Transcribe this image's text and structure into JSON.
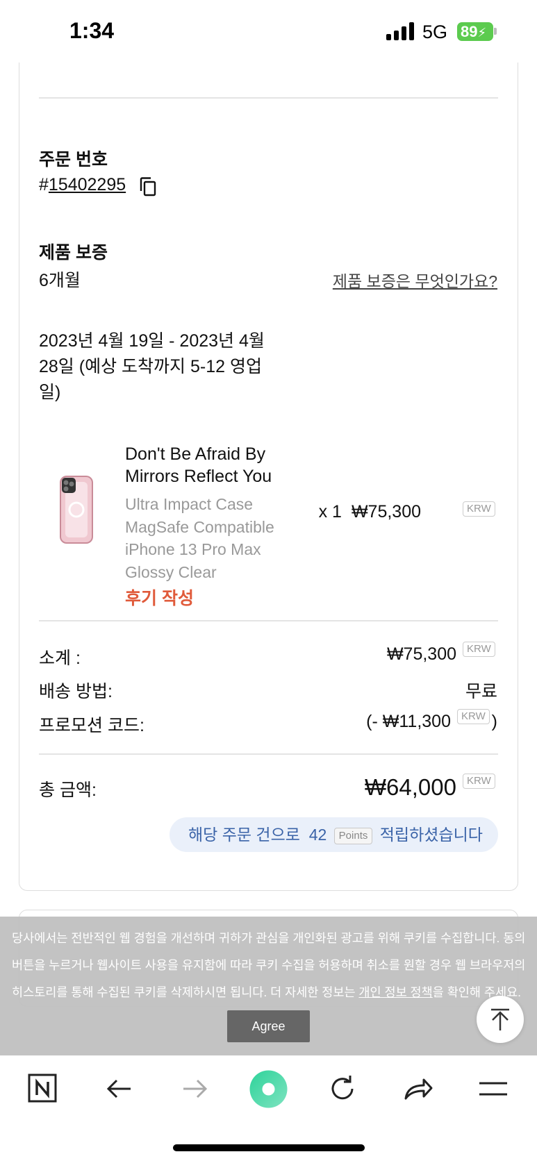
{
  "status_bar": {
    "time": "1:34",
    "network": "5G",
    "battery": "89"
  },
  "order": {
    "order_number_label": "주문 번호",
    "order_number_prefix": "#",
    "order_number": "15402295",
    "warranty_label": "제품 보증",
    "warranty_value": "6개월",
    "warranty_link": "제품 보증은 무엇인가요?",
    "delivery_estimate": "2023년 4월 19일 - 2023년 4월 28일 (예상 도착까지 5-12 영업일)"
  },
  "product": {
    "name": "Don't Be Afraid By Mirrors Reflect You",
    "variant_lines": [
      "Ultra Impact Case",
      "MagSafe Compatible",
      "iPhone 13 Pro Max",
      "Glossy Clear"
    ],
    "review_link": "후기 작성",
    "quantity": "x 1",
    "price": "₩75,300",
    "currency": "KRW"
  },
  "summary": {
    "subtotal_label": "소계 :",
    "subtotal_value": "₩75,300",
    "shipping_label": "배송 방법:",
    "shipping_value": "무료",
    "promo_label": "프로모션 코드:",
    "promo_prefix": "(- ",
    "promo_value": "₩11,300",
    "promo_suffix": ")",
    "total_label": "총 금액:",
    "total_value": "₩64,000",
    "currency": "KRW"
  },
  "points": {
    "text_before": "해당 주문 건으로",
    "amount": "42",
    "unit": "Points",
    "text_after": "적립하셨습니다"
  },
  "cookie_banner": {
    "text": "당사에서는 전반적인 웹 경험을 개선하며 귀하가 관심을 개인화된 광고를 위해 쿠키를 수집합니다. 동의 버튼을 누르거나 웹사이트 사용을 유지함에 따라 쿠키 수집을 허용하며 취소를 원할 경우 웹 브라우저의 히스토리를 통해 수집된 쿠키를 삭제하시면 됩니다. 더 자세한 정보는 ",
    "link": "개인 정보 정책",
    "text_after": "을 확인해 주세요.",
    "agree_label": "Agree"
  },
  "colors": {
    "review_accent": "#e05a3a",
    "points_text": "#3a63a8",
    "points_bg": "#eaf0fa",
    "battery": "#5ccb4f",
    "browser_accent": "#3fd6a0"
  },
  "toolbar_icons": [
    "naver-n-icon",
    "back-arrow-icon",
    "forward-arrow-icon",
    "green-dot-icon",
    "reload-icon",
    "share-icon",
    "menu-icon"
  ]
}
